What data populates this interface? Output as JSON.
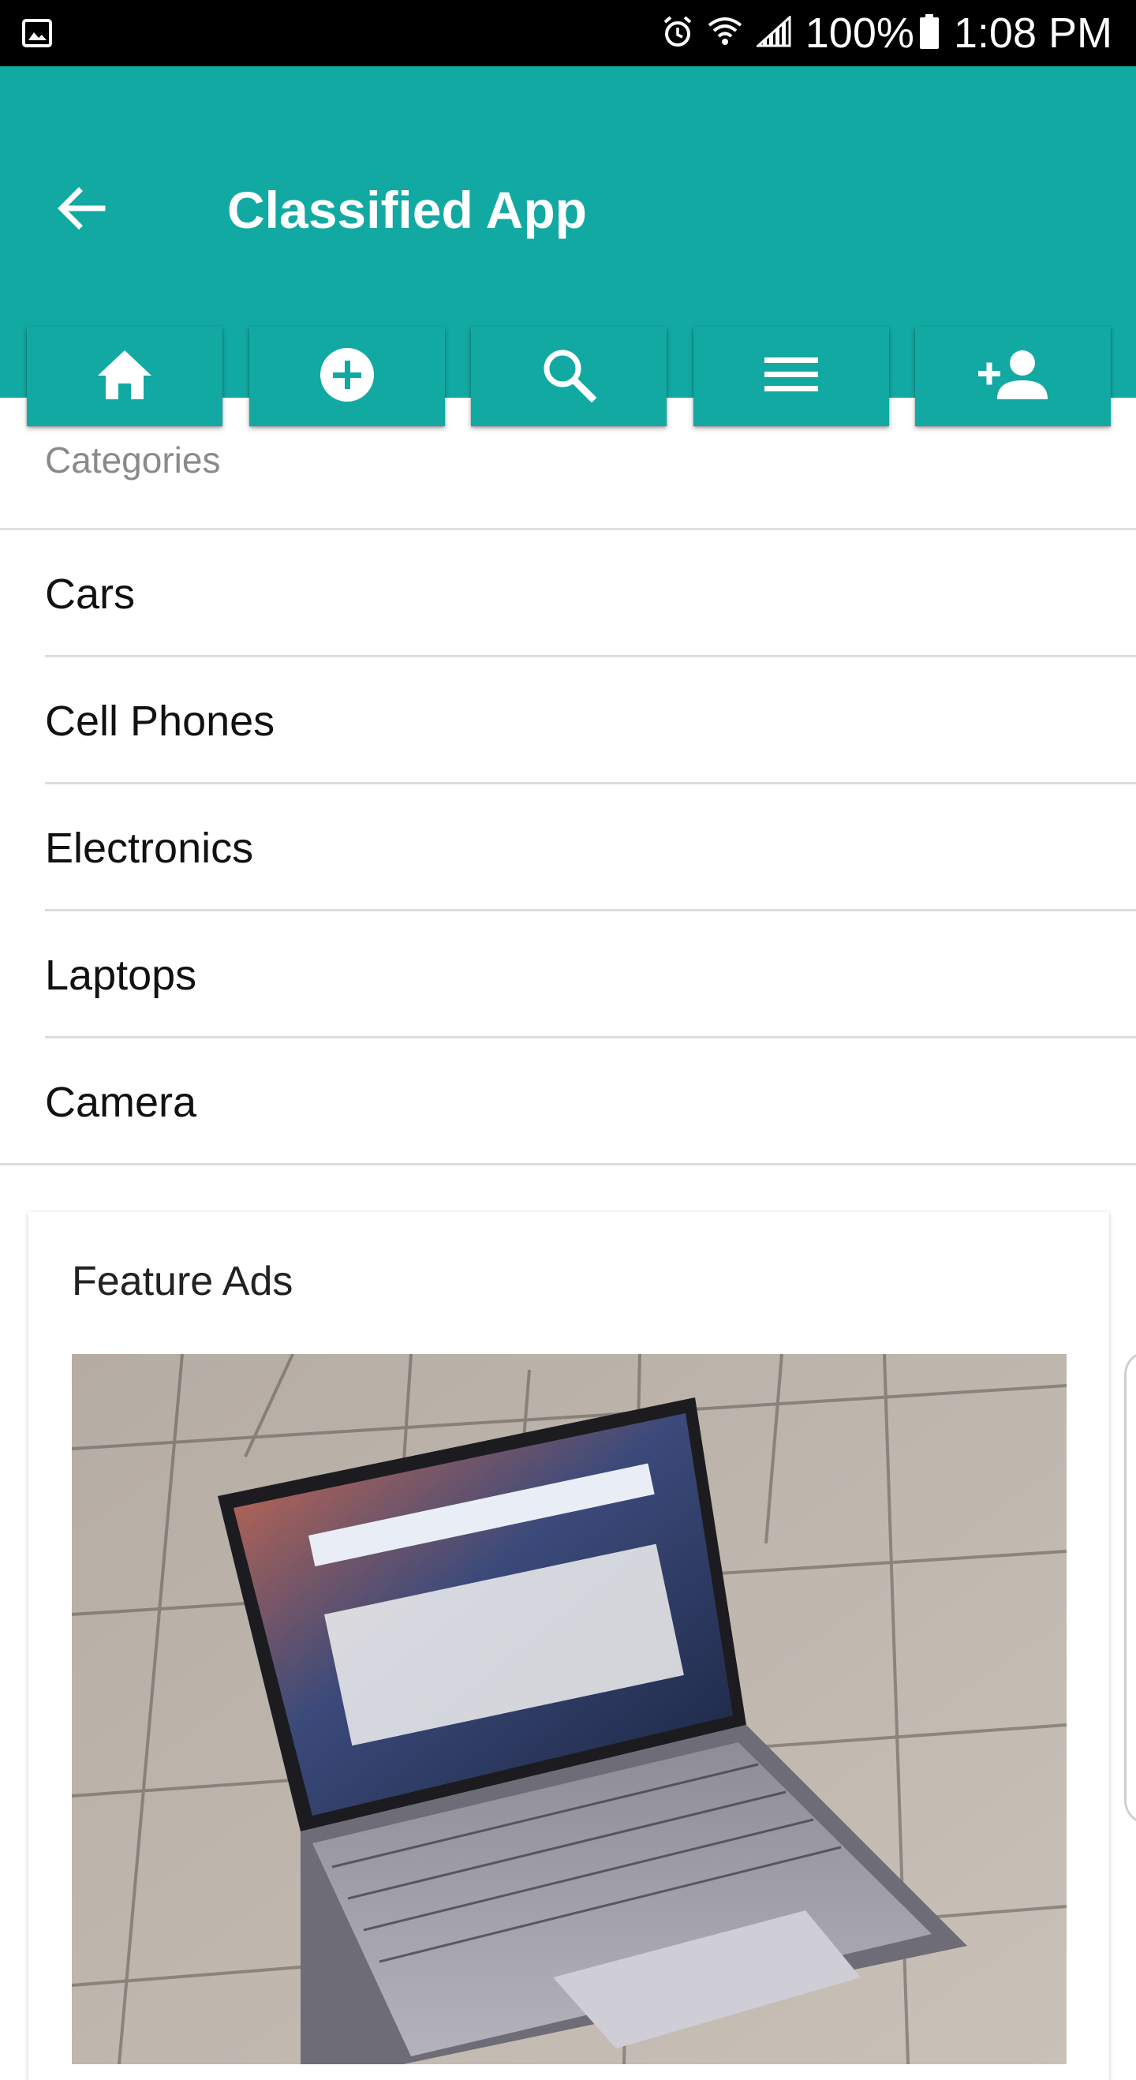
{
  "status_bar": {
    "battery": "100%",
    "time": "1:08 PM",
    "icons": [
      "image-icon",
      "alarm-icon",
      "wifi-icon",
      "signal-icon",
      "battery-icon"
    ]
  },
  "app_bar": {
    "title": "Classified App",
    "color": "#12a9a3",
    "back_icon": "arrow-back-icon",
    "toolbar_icons": [
      "home-icon",
      "add-circle-icon",
      "search-icon",
      "menu-icon",
      "add-user-icon"
    ]
  },
  "categories": {
    "header": "Categories",
    "items": [
      {
        "label": "Cars"
      },
      {
        "label": "Cell Phones"
      },
      {
        "label": "Electronics"
      },
      {
        "label": "Laptops"
      },
      {
        "label": "Camera"
      }
    ]
  },
  "feature_ads": {
    "title": "Feature Ads",
    "image_icon": "laptop-photo"
  }
}
